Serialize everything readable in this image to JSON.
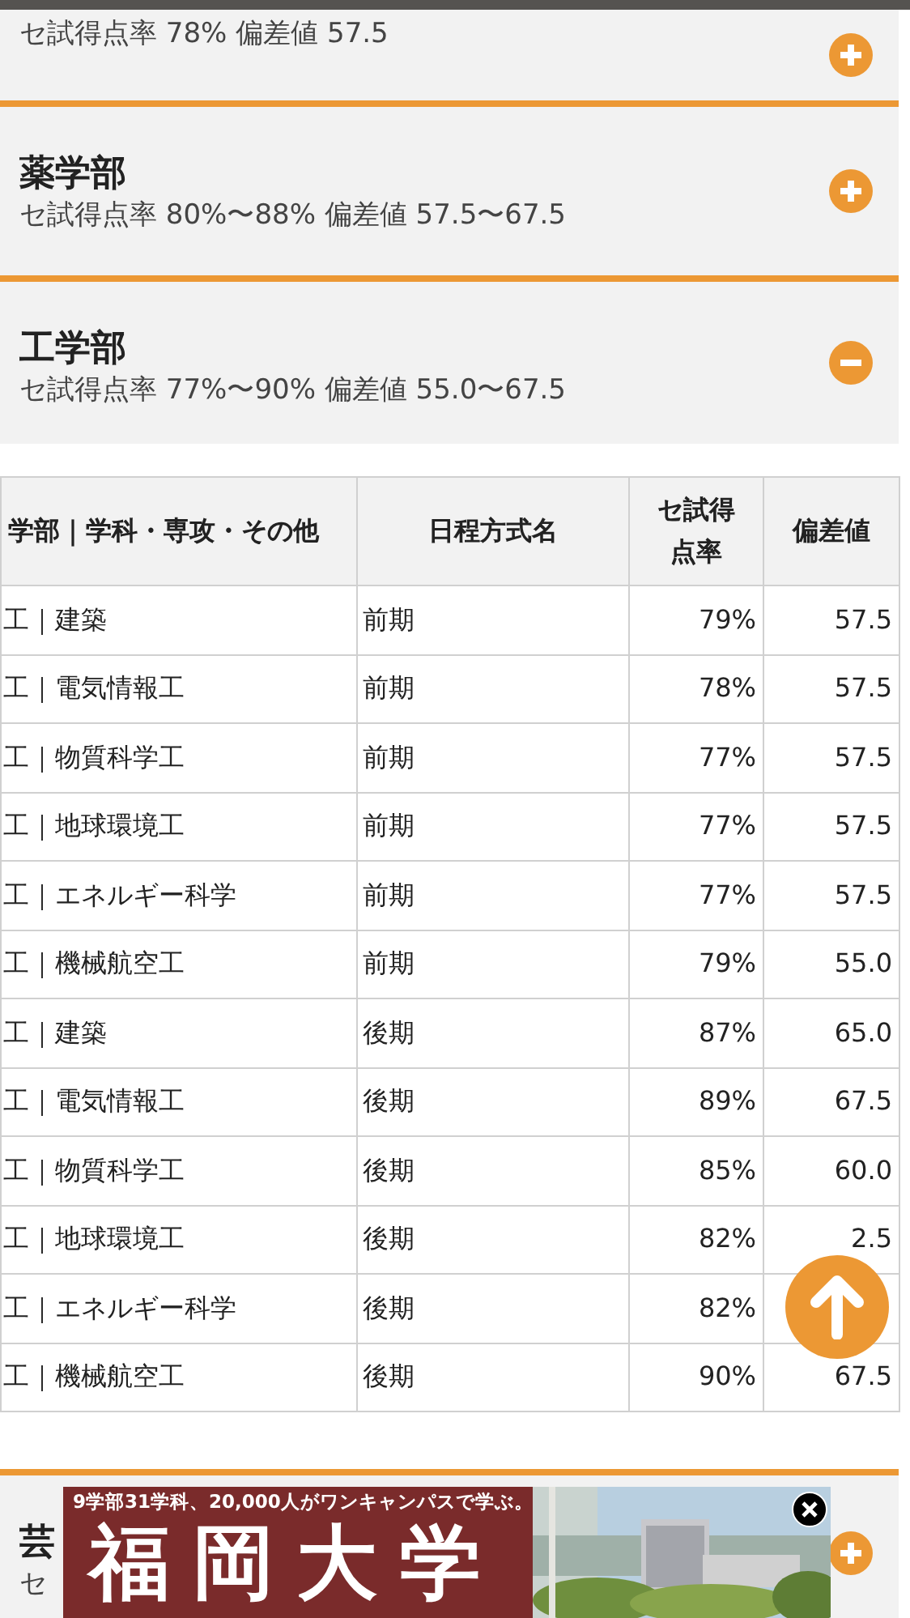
{
  "sections_top": [
    {
      "subtitle": "セ試得点率 78% 偏差値 57.5",
      "expanded": false
    },
    {
      "title": "薬学部",
      "subtitle": "セ試得点率 80%〜88% 偏差値 57.5〜67.5",
      "expanded": false
    },
    {
      "title": "工学部",
      "subtitle": "セ試得点率 77%〜90% 偏差値 55.0〜67.5",
      "expanded": true
    }
  ],
  "table": {
    "columns": [
      "学部｜学科・専攻・その他",
      "日程方式名",
      "セ試得点率",
      "偏差値"
    ],
    "rows": [
      [
        "工｜建築",
        "前期",
        "79%",
        "57.5"
      ],
      [
        "工｜電気情報工",
        "前期",
        "78%",
        "57.5"
      ],
      [
        "工｜物質科学工",
        "前期",
        "77%",
        "57.5"
      ],
      [
        "工｜地球環境工",
        "前期",
        "77%",
        "57.5"
      ],
      [
        "工｜エネルギー科学",
        "前期",
        "77%",
        "57.5"
      ],
      [
        "工｜機械航空工",
        "前期",
        "79%",
        "55.0"
      ],
      [
        "工｜建築",
        "後期",
        "87%",
        "65.0"
      ],
      [
        "工｜電気情報工",
        "後期",
        "89%",
        "67.5"
      ],
      [
        "工｜物質科学工",
        "後期",
        "85%",
        "60.0"
      ],
      [
        "工｜地球環境工",
        "後期",
        "82%",
        "2.5"
      ],
      [
        "工｜エネルギー科学",
        "後期",
        "82%",
        ""
      ],
      [
        "工｜機械航空工",
        "後期",
        "90%",
        "67.5"
      ]
    ]
  },
  "section_bottom": {
    "title": "芸",
    "subtitle": "セ",
    "expanded": false
  },
  "ad": {
    "tagline": "9学部31学科、20,000人がワンキャンパスで学ぶ。",
    "headline": "福岡大学"
  }
}
